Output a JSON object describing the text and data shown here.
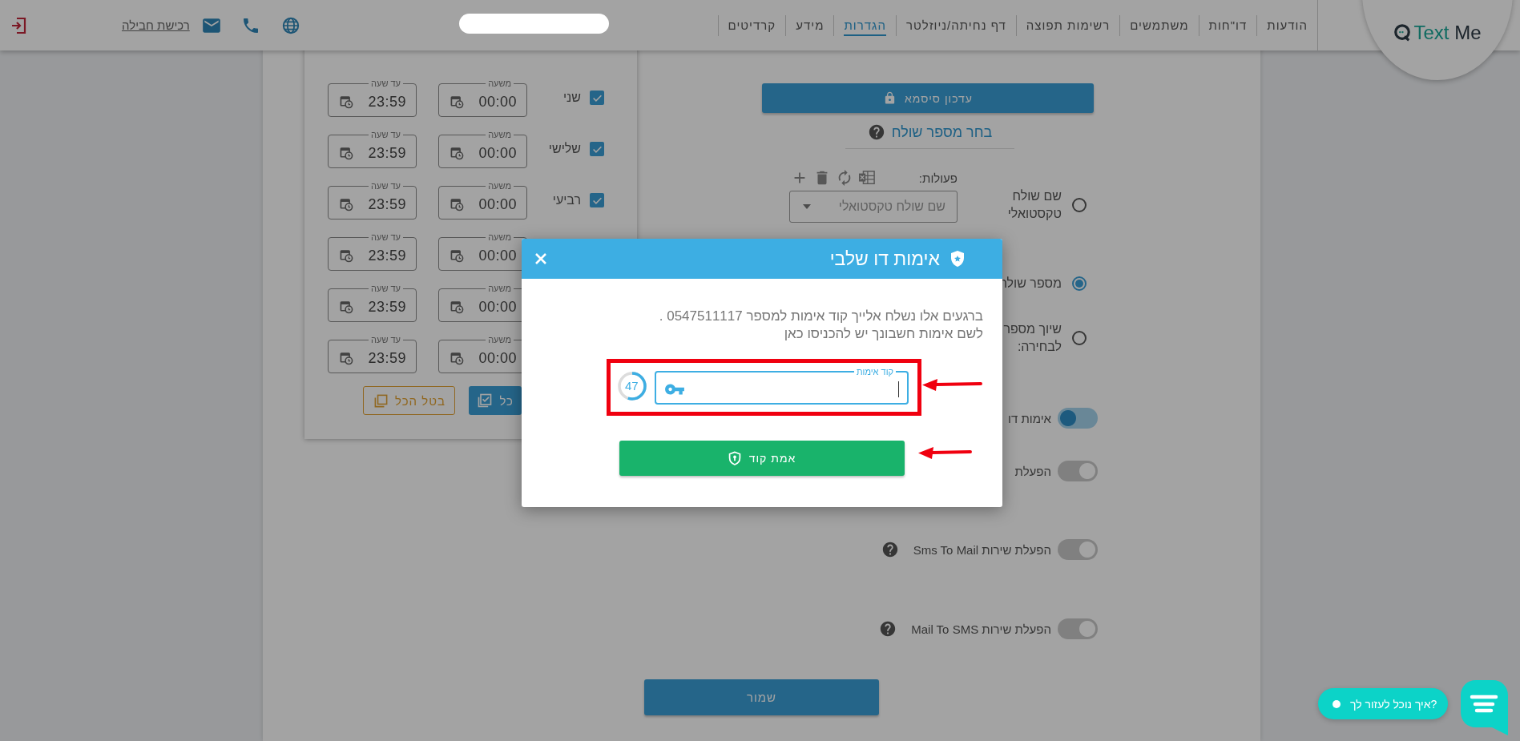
{
  "header": {
    "logo": {
      "text": "Text",
      "accent": "Me"
    },
    "nav": [
      {
        "label": "הודעות",
        "selected": false
      },
      {
        "label": "דו\"חות",
        "selected": false
      },
      {
        "label": "משתמשים",
        "selected": false
      },
      {
        "label": "רשימות תפוצה",
        "selected": false
      },
      {
        "label": "דף נחיתה/ניוזלטר",
        "selected": false
      },
      {
        "label": "הגדרות",
        "selected": true
      },
      {
        "label": "מידע",
        "selected": false
      },
      {
        "label": "קרדיטים",
        "selected": false
      }
    ],
    "buy_link": "רכישת חבילה"
  },
  "settings": {
    "update_password": "עדכון סיסמא",
    "sender_title": "בחר מספר שולח",
    "actions_label": "פעולות:",
    "sender_options": [
      {
        "lines": [
          "שם שולח",
          "טקסטואלי"
        ],
        "selected": false,
        "dropdown_placeholder": "שם שולח טקסטואלי"
      },
      {
        "lines": [
          "מספר שולח"
        ],
        "selected": true
      },
      {
        "lines": [
          "שיוך מספר",
          "לבחירה:"
        ],
        "selected": false
      }
    ],
    "toggles": [
      {
        "label": "אימות דו",
        "on": true,
        "help": false
      },
      {
        "label": "הפעלת",
        "on": false,
        "help": false
      },
      {
        "label": "הפעלת שירות Sms To Mail",
        "on": false,
        "help": true
      },
      {
        "label": "הפעלת שירות Mail To SMS",
        "on": false,
        "help": true
      }
    ]
  },
  "schedule": {
    "rows": [
      {
        "day": "שני",
        "checked": true,
        "from_label": "משעה",
        "from": "00:00",
        "to_label": "עד שעה",
        "to": "23:59"
      },
      {
        "day": "שלישי",
        "checked": true,
        "from_label": "משעה",
        "from": "00:00",
        "to_label": "עד שעה",
        "to": "23:59"
      },
      {
        "day": "רביעי",
        "checked": true,
        "from_label": "משעה",
        "from": "00:00",
        "to_label": "עד שעה",
        "to": "23:59"
      },
      {
        "from_label": "משעה",
        "from": "00:00",
        "to_label": "עד שעה",
        "to": "23:59"
      },
      {
        "from_label": "משעה",
        "from": "00:00",
        "to_label": "עד שעה",
        "to": "23:59"
      },
      {
        "from_label": "משעה",
        "from": "00:00",
        "to_label": "עד שעה",
        "to": "23:59"
      }
    ],
    "buttons": [
      {
        "kind": "filled",
        "label": "כל"
      },
      {
        "kind": "outline",
        "label": "בטל הכל"
      }
    ]
  },
  "save_button": "שמור",
  "modal": {
    "title": "אימות דו שלבי",
    "lines": [
      "ברגעים אלו נשלח אלייך קוד אימות למספר 0547511117 .",
      "לשם אימות חשבונך יש להכניסו כאן"
    ],
    "code_field": {
      "label": "קוד אימות"
    },
    "countdown": {
      "value": "47",
      "level": 0.55
    },
    "verify_button": "אמת קוד"
  },
  "chat": {
    "prompt": "איך נוכל לעזור לך?"
  }
}
